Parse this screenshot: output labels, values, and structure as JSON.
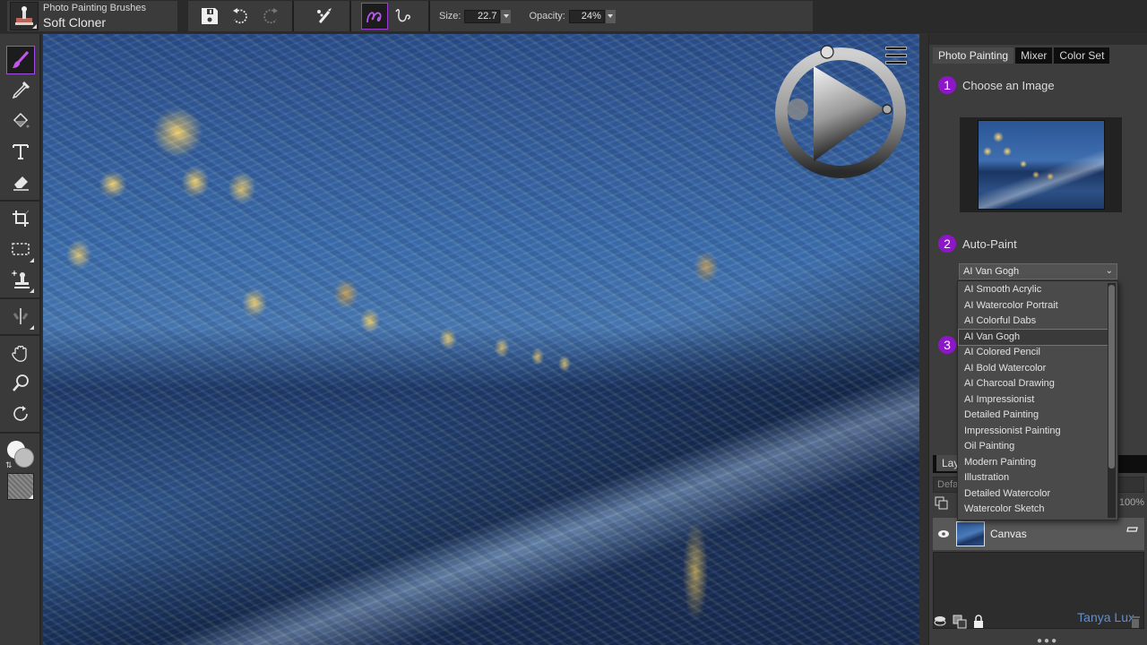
{
  "brush": {
    "category": "Photo Painting Brushes",
    "variant": "Soft Cloner"
  },
  "property_bar": {
    "size_label": "Size:",
    "size_value": "22.7",
    "opacity_label": "Opacity:",
    "opacity_value": "24%",
    "icons": [
      "save-icon",
      "undo-icon",
      "redo-icon",
      "clone-brush-icon",
      "freehand-stroke-icon",
      "straight-line-stroke-icon"
    ]
  },
  "toolbox": {
    "tools": [
      "brush",
      "dropper",
      "paint-bucket",
      "text",
      "eraser",
      "crop",
      "rectangular-selection",
      "cloner",
      "divine-proportion",
      "grabber",
      "magnifier",
      "rotate-page",
      "color-swatches",
      "paper-swatch"
    ],
    "active_tool": "brush",
    "main_color": "#f4f4f4",
    "additional_color": "#bdbdbd"
  },
  "canvas": {
    "description": "Van Gogh style painting of Pont Alexandre III at night"
  },
  "right_panel": {
    "tabs": [
      {
        "label": "Photo Painting",
        "active": true
      },
      {
        "label": "Mixer",
        "active": false
      },
      {
        "label": "Color Set",
        "active": false
      }
    ],
    "steps": [
      {
        "number": "1",
        "label": "Choose an Image"
      },
      {
        "number": "2",
        "label": "Auto-Paint"
      },
      {
        "number": "3",
        "label": ""
      }
    ],
    "auto_paint": {
      "selected": "AI Van Gogh",
      "options": [
        "AI Smooth Acrylic",
        "AI Watercolor Portrait",
        "AI Colorful Dabs",
        "AI Van Gogh",
        "AI Colored Pencil",
        "AI Bold Watercolor",
        "AI Charcoal Drawing",
        "AI Impressionist",
        "Detailed Painting",
        "Impressionist Painting",
        "Oil Painting",
        "Modern Painting",
        "Illustration",
        "Detailed Watercolor",
        "Watercolor Sketch"
      ]
    },
    "accent_color": "#8d16c9"
  },
  "layers": {
    "tab_label": "Lay",
    "composite_label": "Defa",
    "opacity": "100%",
    "items": [
      {
        "name": "Canvas",
        "visible": true
      }
    ],
    "signature": "Tanya Lux"
  }
}
